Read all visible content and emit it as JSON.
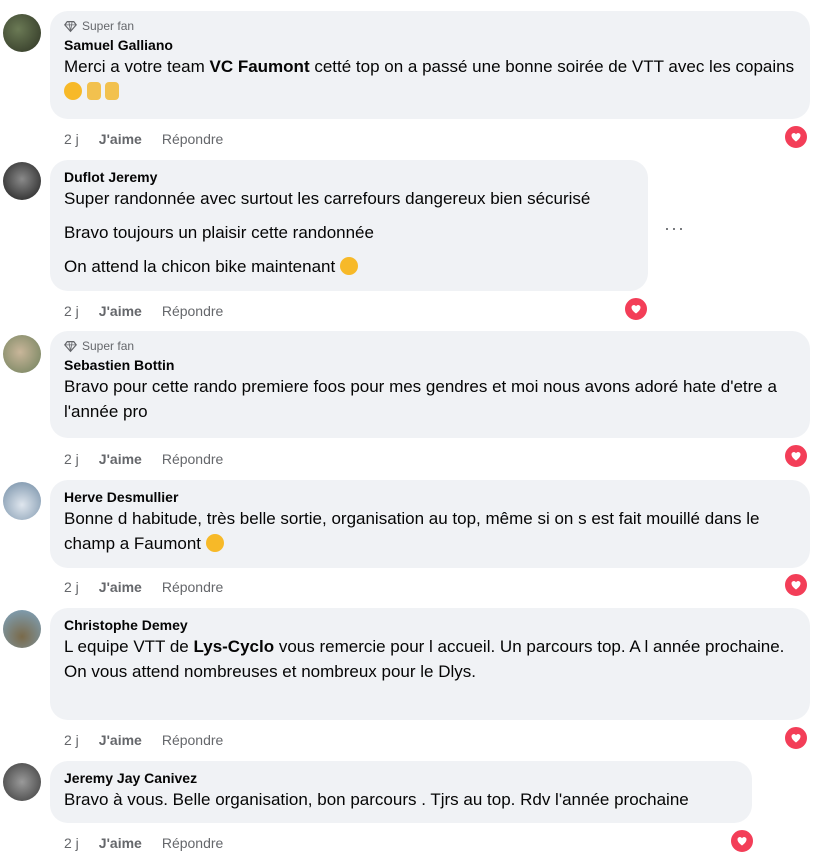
{
  "comments": [
    {
      "badge": "Super fan",
      "author": "Samuel Galliano",
      "text_before": "Merci a votre team ",
      "mention": "VC Faumont",
      "text_after": " cetté top on a passé une bonne soirée de VTT avec les copains",
      "time": "2 j",
      "like": "J'aime",
      "reply": "Répondre"
    },
    {
      "author": "Duflot Jeremy",
      "lines": [
        "Super randonnée avec surtout les carrefours dangereux bien sécurisé",
        "Bravo toujours un plaisir cette randonnée",
        "On attend la chicon bike maintenant"
      ],
      "time": "2 j",
      "like": "J'aime",
      "reply": "Répondre",
      "more": "···"
    },
    {
      "badge": "Super fan",
      "author": "Sebastien Bottin",
      "text": "Bravo pour cette rando premiere foos pour mes gendres et moi nous avons adoré hate d'etre a l'année pro",
      "time": "2 j",
      "like": "J'aime",
      "reply": "Répondre"
    },
    {
      "author": "Herve Desmullier",
      "text": "Bonne d habitude, très belle sortie, organisation au top, même si on s est fait mouillé dans le champ a Faumont",
      "time": "2 j",
      "like": "J'aime",
      "reply": "Répondre"
    },
    {
      "author": "Christophe Demey",
      "text_before": "L equipe VTT de ",
      "mention": "Lys-Cyclo",
      "text_after": " vous remercie pour l accueil. Un parcours top. A l année prochaine.",
      "line2": "On vous attend nombreuses et nombreux pour le Dlys.",
      "time": "2 j",
      "like": "J'aime",
      "reply": "Répondre"
    },
    {
      "author": "Jeremy Jay Canivez",
      "text": "Bravo à vous. Belle organisation, bon parcours . Tjrs au top. Rdv l'année prochaine",
      "time": "2 j",
      "like": "J'aime",
      "reply": "Répondre"
    }
  ],
  "colors": {
    "bubble": "#f0f2f5",
    "heart": "#f33e58",
    "muted": "#65676b"
  },
  "icons": [
    "diamond-icon",
    "heart-icon",
    "more-icon",
    "emoji-icon"
  ]
}
